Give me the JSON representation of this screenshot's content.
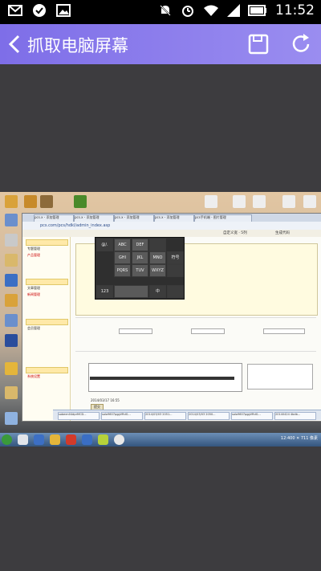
{
  "status_bar": {
    "time": "11:52",
    "left_icons": [
      "mail-icon",
      "check-icon",
      "image-icon"
    ],
    "right_icons": [
      "mute-icon",
      "alarm-icon",
      "wifi-icon",
      "signal-icon",
      "battery-icon"
    ]
  },
  "app_bar": {
    "title": "抓取电脑屏幕",
    "background_start": "#7e6ee8",
    "background_end": "#9a8df0",
    "actions": [
      "save-icon",
      "refresh-icon"
    ]
  },
  "screenshot": {
    "address_url": "pcs.com/pcs/hdkl/admin_index.asp",
    "tabs": [
      "pcs.x - 添加管理",
      "pcs.x - 添加管理",
      "pcs.x - 添加管理",
      "pcs.x - 添加管理",
      "pcs手机端 - 图片管理"
    ],
    "tool_texts": [
      "自定义宽 · 5列",
      "生成代码"
    ],
    "ime_keys": [
      "@/.",
      "ABC",
      "DEF",
      "GHI",
      "JKL",
      "MNO",
      "PQRS",
      "TUV",
      "WXYZ",
      "123",
      "中",
      "符号"
    ],
    "nav_items": [
      "专题管理",
      "产品管理",
      "文章管理",
      "新闻管理",
      "会员管理",
      "系统设置"
    ],
    "confirm_label": "提交",
    "date_text": "2014/03/17 16:55",
    "taskbar_items": [
      "sobeen04dprMCD...",
      "solo9607pggVRdG...",
      "2014/03/03 2051...",
      "2014/03/03 2050...",
      "solo9607pggVRdG...",
      "20140424 4bdb..."
    ],
    "tray_text": "12:400 ✕ 711 像素"
  }
}
